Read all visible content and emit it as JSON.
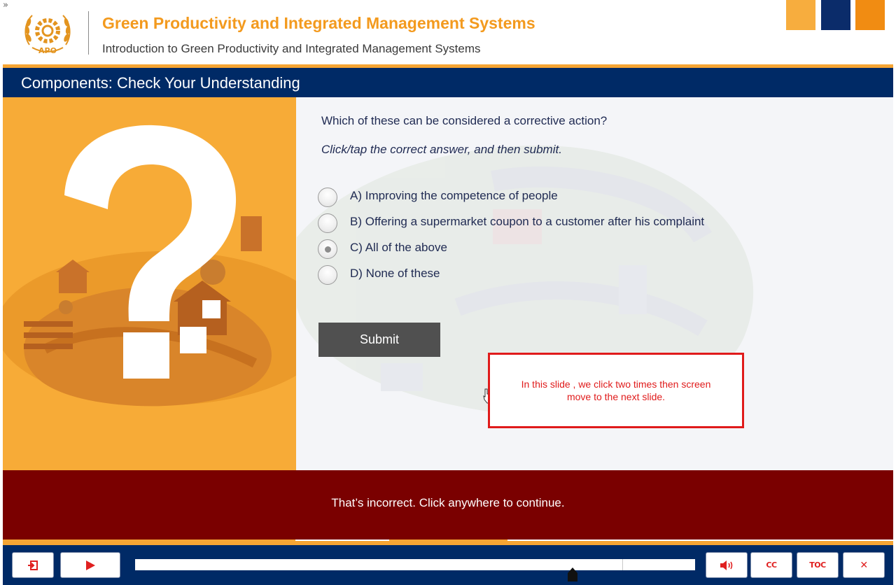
{
  "header": {
    "expand_glyph": "»",
    "title": "Green Productivity and Integrated Management Systems",
    "subtitle": "Introduction to Green Productivity and Integrated Management Systems",
    "logo_text": "APO",
    "brand_colors": [
      "#f7ad3e",
      "#0b2c6a",
      "#f18c12"
    ]
  },
  "slide": {
    "title": "Components: Check Your Understanding",
    "question": "Which of these can be considered a corrective action?",
    "instruction": "Click/tap the correct answer, and then submit.",
    "options": [
      {
        "label": "A) Improving the competence of people",
        "selected": false
      },
      {
        "label": "B) Offering a supermarket coupon to a customer after his complaint",
        "selected": false
      },
      {
        "label": "C) All of the above",
        "selected": true
      },
      {
        "label": "D) None of these",
        "selected": false
      }
    ],
    "submit_label": "Submit",
    "annotation": "In this slide , we click two times then screen move to the next slide."
  },
  "feedback": {
    "text": "That’s incorrect. Click anywhere to continue."
  },
  "player": {
    "exit_icon": "exit-icon",
    "play_icon": "play-icon",
    "volume_icon": "volume-icon",
    "cc_label": "CC",
    "toc_label": "TOC",
    "close_label": "✕"
  },
  "colors": {
    "navy": "#002a66",
    "orange": "#f6a533",
    "feedback_red": "#7a0000",
    "annotation_red": "#e01b1b"
  }
}
